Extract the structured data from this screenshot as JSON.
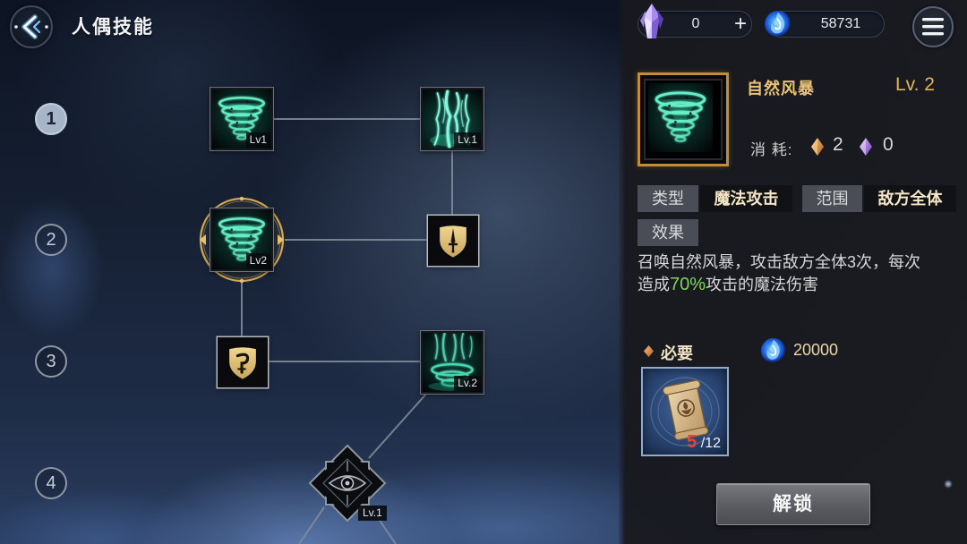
{
  "header": {
    "title": "人偶技能",
    "back_icon": "back-arrow-icon"
  },
  "currency": {
    "crystal": {
      "icon": "crystal-icon",
      "value": "0",
      "add_label": "+"
    },
    "flame": {
      "icon": "blue-flame-icon",
      "value": "58731"
    }
  },
  "menu": {
    "icon": "hamburger-menu-icon"
  },
  "tiers": {
    "items": [
      "1",
      "2",
      "3",
      "4"
    ],
    "selected_index": 0
  },
  "skill_tree": {
    "nodes": [
      {
        "icon": "tornado-icon",
        "level": "Lv1"
      },
      {
        "icon": "green-lightning-icon",
        "level": "Lv.1"
      },
      {
        "icon": "tornado-icon",
        "level": "Lv2",
        "selected": true
      },
      {
        "icon": "shield-dagger-icon"
      },
      {
        "icon": "shield-hook-icon"
      },
      {
        "icon": "green-vortex-icon",
        "level": "Lv.2"
      },
      {
        "icon": "eye-star-icon",
        "level": "Lv.1"
      }
    ]
  },
  "detail": {
    "icon": "tornado-icon",
    "name": "自然风暴",
    "level": "Lv. 2",
    "cost_label": "消 耗:",
    "costs": [
      {
        "icon": "orange-gem-icon",
        "value": "2"
      },
      {
        "icon": "purple-gem-icon",
        "value": "0"
      }
    ],
    "type_label": "类型",
    "type_value": "魔法攻击",
    "range_label": "范围",
    "range_value": "敌方全体",
    "effect_label": "效果",
    "description": {
      "line1": "召唤自然风暴，攻击敌方全体3次，每次",
      "line2_before": "造成",
      "highlight": "70%",
      "line2_after": "攻击的魔法伤害"
    },
    "requirement_label": "必要",
    "requirement_cost": {
      "icon": "blue-flame-icon",
      "value": "20000"
    },
    "required_item": {
      "icon": "scroll-icon",
      "owned": "5",
      "total": "/12"
    },
    "unlock_label": "解锁"
  },
  "colors": {
    "name_gold": "#e9c277",
    "level_gold": "#e3b553",
    "highlight_green": "#7fd65c",
    "owned_count_red": "#e0463a",
    "selected_ring_gold": "#d2a84e",
    "panel_bg": "#1a1b20"
  }
}
